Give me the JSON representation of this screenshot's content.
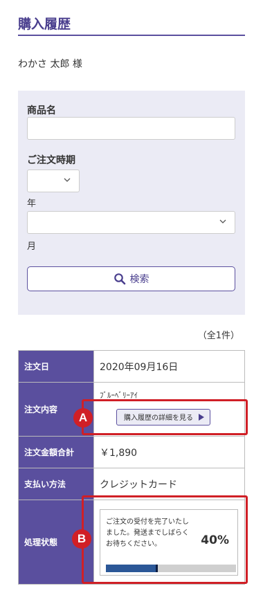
{
  "page": {
    "title": "購入履歴",
    "customer": "わかさ 太郎 様"
  },
  "search": {
    "product_label": "商品名",
    "product_value": "",
    "period_label": "ご注文時期",
    "year_value": "",
    "year_unit": "年",
    "month_value": "",
    "month_unit": "月",
    "button_label": "検索",
    "button_icon": "search-icon"
  },
  "results": {
    "count": "（全1件）"
  },
  "order": {
    "date_label": "注文日",
    "date": "2020年09月16日",
    "contents_label": "注文内容",
    "product": "ﾌﾞﾙｰﾍﾞﾘｰｱｲ",
    "detail_button": "購入履歴の詳細を見る",
    "total_label": "注文金額合計",
    "total": "￥1,890",
    "payment_label": "支払い方法",
    "payment": "クレジットカード",
    "status_label": "処理状態",
    "status_text": "ご注文の受付を完了いたしました。発送までしばらくお待ちください。",
    "progress_label": "40%",
    "progress": 0.4
  },
  "callouts": {
    "a": "A",
    "b": "B"
  },
  "colors": {
    "brand": "#5a4f9e",
    "callout": "#d01f26",
    "progress": "#2b5797"
  }
}
